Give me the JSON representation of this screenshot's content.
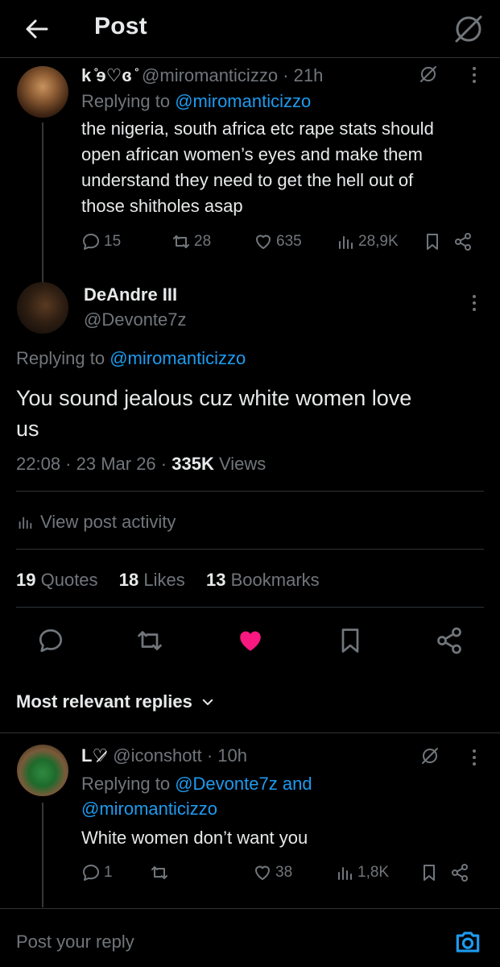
{
  "header": {
    "title": "Post"
  },
  "parent_reply": {
    "display_name": "k ̊ɘ♡ɞ ̊",
    "handle": "@miromanticizzo",
    "time": "21h",
    "replying_prefix": "Replying to",
    "replying_to": "@miromanticizzo",
    "text_lines": [
      "the nigeria, south africa etc rape stats should",
      "open african women’s eyes and make them",
      "understand they need to get the hell out of",
      "those shitholes asap"
    ],
    "replies": "15",
    "reposts": "28",
    "likes": "635",
    "views": "28,9K"
  },
  "main_post": {
    "display_name": "DeAndre III",
    "handle": "@Devonte7z",
    "replying_prefix": "Replying to",
    "replying_to": "@miromanticizzo",
    "text_lines": [
      "You sound jealous cuz white women love",
      "us"
    ],
    "timestamp": "22:08 · 23 Mar 26 ·",
    "views_count": "335K",
    "views_label": "Views",
    "activity_label": "View post activity",
    "quotes_count": "19",
    "quotes_label": "Quotes",
    "likes_count": "18",
    "likes_label": "Likes",
    "bookmarks_count": "13",
    "bookmarks_label": "Bookmarks"
  },
  "sort": {
    "label": "Most relevant replies"
  },
  "reply": {
    "display_name": "L♡̷",
    "handle": "@iconshott",
    "time": "10h",
    "replying_prefix": "Replying to",
    "replying_to_1": "@Devonte7z",
    "replying_and": "and",
    "replying_to_2": "@miromanticizzo",
    "text": "White women don’t want you",
    "replies": "1",
    "likes": "38",
    "views": "1,8K"
  },
  "composer": {
    "placeholder": "Post your reply"
  },
  "colors": {
    "like_active": "#f91880",
    "link": "#1d9bf0",
    "muted": "#71767b"
  },
  "icons": [
    "back-arrow-icon",
    "grok-icon",
    "more-icon",
    "reply-icon",
    "repost-icon",
    "like-icon",
    "views-icon",
    "bookmark-icon",
    "share-icon",
    "camera-icon",
    "chevron-down-icon"
  ]
}
